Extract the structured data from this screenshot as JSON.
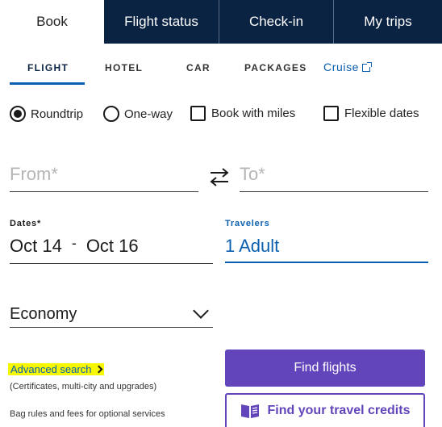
{
  "top_tabs": [
    {
      "label": "Book",
      "active": true
    },
    {
      "label": "Flight status",
      "active": false
    },
    {
      "label": "Check-in",
      "active": false
    },
    {
      "label": "My trips",
      "active": false
    }
  ],
  "sub_tabs": {
    "flight": "FLIGHT",
    "hotel": "HOTEL",
    "car": "CAR",
    "packages": "PACKAGES",
    "cruise": "Cruise"
  },
  "trip_options": {
    "roundtrip": "Roundtrip",
    "one_way": "One-way",
    "book_with_miles": "Book with miles",
    "flexible_dates": "Flexible dates"
  },
  "from": {
    "placeholder": "From*"
  },
  "to": {
    "placeholder": "To*"
  },
  "dates": {
    "label": "Dates*",
    "depart": "Oct 14",
    "separator": "-",
    "return": "Oct 16"
  },
  "travelers": {
    "label": "Travelers",
    "value": "1 Adult"
  },
  "cabin": {
    "value": "Economy"
  },
  "advanced": {
    "label": "Advanced search",
    "note": "(Certificates, multi-city and upgrades)"
  },
  "bag_link": "Bag rules and fees for optional services",
  "buttons": {
    "find_flights": "Find flights",
    "find_credits": "Find your travel credits"
  },
  "colors": {
    "navy": "#0b2343",
    "purple": "#6244bb",
    "link_blue": "#0b5fb0",
    "highlight": "#f7f700"
  }
}
